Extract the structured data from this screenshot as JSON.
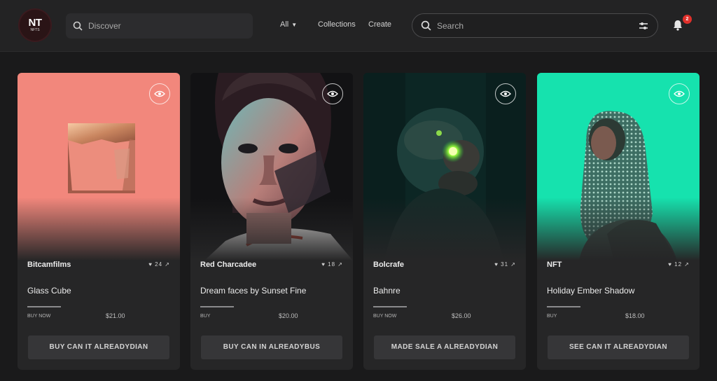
{
  "header": {
    "logo_text": "NT",
    "logo_sub": "NFTS",
    "search_placeholder": "Discover",
    "nav": [
      {
        "label": "All",
        "has_caret": true
      },
      {
        "label": "Collections",
        "has_caret": false
      },
      {
        "label": "Create",
        "has_caret": false
      }
    ],
    "search2_placeholder": "Search",
    "notification_count": "2"
  },
  "colors": {
    "card1_bg": "#f2877c",
    "card4_bg": "#16e2ae",
    "badge": "#e0302b"
  },
  "cards": [
    {
      "creator": "Bitcamfilms",
      "stats": "♥ 24 ↗",
      "title": "Glass Cube",
      "meta_left": "BUY NOW",
      "meta_right": "$21.00",
      "button": "BUY CAN IT ALREADYDIAN",
      "icon": "eye-icon"
    },
    {
      "creator": "Red Charcadee",
      "stats": "♥ 18 ↗",
      "title": "Dream faces by Sunset Fine",
      "meta_left": "BUY",
      "meta_right": "$20.00",
      "button": "BUY CAN IN ALREADYBUS",
      "icon": "eye-icon"
    },
    {
      "creator": "Bolcrafe",
      "stats": "♥ 31 ↗",
      "title": "Bahnre",
      "meta_left": "BUY NOW",
      "meta_right": "$26.00",
      "button": "MADE SALE A ALREADYDIAN",
      "icon": "eye-icon"
    },
    {
      "creator": "NFT",
      "stats": "♥ 12 ↗",
      "title": "Holiday Ember Shadow",
      "meta_left": "BUY",
      "meta_right": "$18.00",
      "button": "SEE CAN IT ALREADYDIAN",
      "icon": "eye-icon"
    }
  ]
}
